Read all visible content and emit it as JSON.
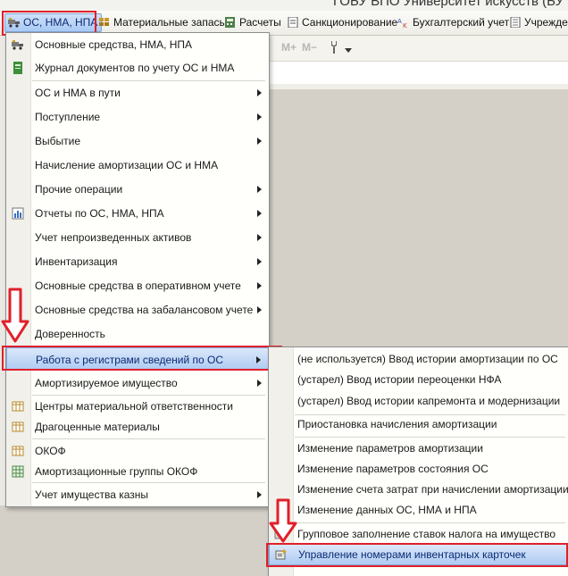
{
  "window": {
    "title": "ГОБУ ВПО Университет искусств (БУ б"
  },
  "menubar": {
    "items": [
      {
        "label": "ОС, НМА, НПА",
        "icon": "truck-icon"
      },
      {
        "label": "Материальные запасы",
        "icon": "boxes-icon"
      },
      {
        "label": "Расчеты",
        "icon": "calculator-icon"
      },
      {
        "label": "Санкционирование",
        "icon": "document-icon"
      },
      {
        "label": "Бухгалтерский учет",
        "icon": "accounting-icon"
      },
      {
        "label": "Учрежден",
        "icon": "institution-icon"
      }
    ]
  },
  "toolbar": {
    "mplus": "M+",
    "mminus": "M−"
  },
  "main_menu": {
    "items": [
      {
        "label": "Основные средства, НМА, НПА",
        "icon": "truck-icon",
        "submenu": false
      },
      {
        "label": "Журнал документов по учету ОС и НМА",
        "icon": "journal-icon",
        "submenu": false
      },
      {
        "label": "ОС и НМА в пути",
        "submenu": true
      },
      {
        "label": "Поступление",
        "submenu": true
      },
      {
        "label": "Выбытие",
        "submenu": true
      },
      {
        "label": "Начисление амортизации ОС и НМА",
        "submenu": false
      },
      {
        "label": "Прочие операции",
        "submenu": true
      },
      {
        "label": "Отчеты по ОС, НМА, НПА",
        "icon": "report-icon",
        "submenu": true
      },
      {
        "label": "Учет непроизведенных активов",
        "submenu": true
      },
      {
        "label": "Инвентаризация",
        "submenu": true
      },
      {
        "label": "Основные средства в оперативном учете",
        "submenu": true
      },
      {
        "label": "Основные средства на забалансовом учете",
        "submenu": true
      },
      {
        "label": "Доверенность",
        "submenu": false
      },
      {
        "label": "Работа с регистрами сведений по ОС",
        "submenu": true,
        "selected": true
      },
      {
        "label": "Амортизируемое имущество",
        "submenu": true
      },
      {
        "label": "Центры материальной ответственности",
        "icon": "table-icon",
        "submenu": false
      },
      {
        "label": "Драгоценные материалы",
        "icon": "table-icon",
        "submenu": false
      },
      {
        "label": "ОКОФ",
        "icon": "table-icon",
        "submenu": false
      },
      {
        "label": "Амортизационные группы ОКОФ",
        "icon": "grid-icon",
        "submenu": false
      },
      {
        "label": "Учет имущества казны",
        "submenu": true
      }
    ]
  },
  "sub_menu": {
    "items": [
      {
        "label": "(не используется) Ввод истории амортизации по ОС"
      },
      {
        "label": "(устарел) Ввод истории переоценки НФА"
      },
      {
        "label": "(устарел) Ввод истории капремонта и модернизации"
      },
      {
        "label": "Приостановка начисления амортизации"
      },
      {
        "label": "Изменение параметров амортизации"
      },
      {
        "label": "Изменение параметров состояния ОС"
      },
      {
        "label": "Изменение счета затрат при начислении амортизации"
      },
      {
        "label": "Изменение данных ОС, НМА и НПА"
      },
      {
        "label": "Групповое заполнение ставок налога на имущество",
        "icon": "group-fill-icon"
      },
      {
        "label": "Управление номерами инвентарных карточек",
        "icon": "card-number-icon",
        "selected": true
      }
    ]
  },
  "colors": {
    "highlight": "#e0202a",
    "selection": "#aecbf2",
    "arrow_fill": "#ffffff",
    "arrow_stroke": "#e0202a"
  }
}
